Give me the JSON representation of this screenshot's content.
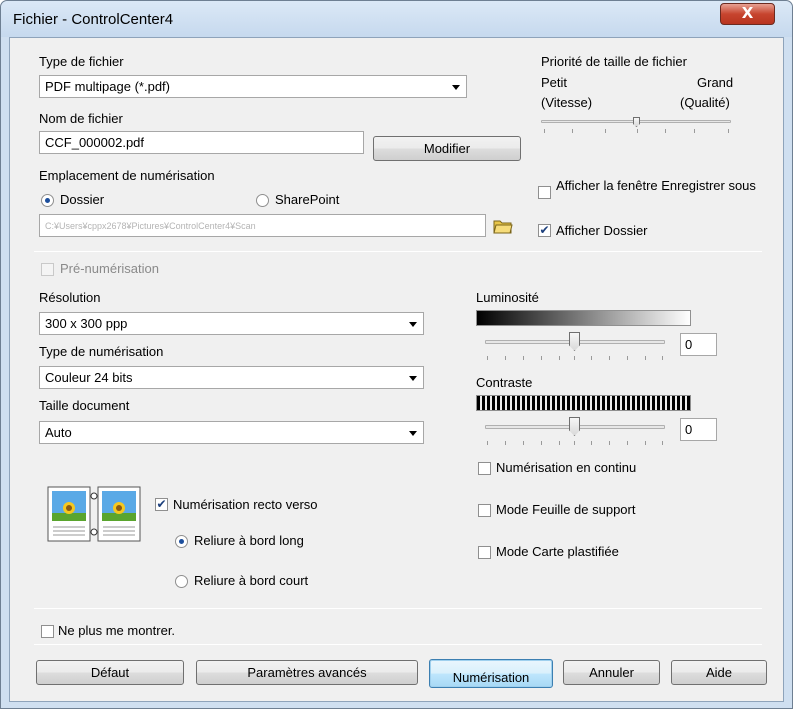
{
  "window": {
    "title": "Fichier - ControlCenter4",
    "close_glyph": "X"
  },
  "file": {
    "type_label": "Type de fichier",
    "type_value": "PDF multipage (*.pdf)",
    "name_label": "Nom de fichier",
    "name_value": "CCF_000002.pdf",
    "modify_button": "Modifier"
  },
  "filesize": {
    "label": "Priorité de taille de fichier",
    "small_label": "Petit",
    "large_label": "Grand",
    "speed_label": "(Vitesse)",
    "quality_label": "(Qualité)",
    "level_fraction": 0.6
  },
  "location": {
    "label": "Emplacement de numérisation",
    "option_folder": "Dossier",
    "option_sharepoint": "SharePoint",
    "selected": "Dossier",
    "path_value": "C:¥Users¥cppx2678¥Pictures¥ControlCenter4¥Scan",
    "folder_icon": "folder-icon",
    "show_save_window": "Afficher la fenêtre Enregistrer sous",
    "show_save_window_checked": false,
    "show_folder": "Afficher Dossier",
    "show_folder_checked": true
  },
  "prescan": {
    "label": "Pré-numérisation",
    "checked": false
  },
  "scan": {
    "resolution_label": "Résolution",
    "resolution_value": "300 x 300 ppp",
    "scan_type_label": "Type de numérisation",
    "scan_type_value": "Couleur 24 bits",
    "doc_size_label": "Taille document",
    "doc_size_value": "Auto"
  },
  "brightness": {
    "label": "Luminosité",
    "value": "0",
    "level_fraction": 0.5
  },
  "contrast": {
    "label": "Contraste",
    "value": "0",
    "level_fraction": 0.5
  },
  "duplex": {
    "icon": "duplex-book-icon",
    "label": "Numérisation recto verso",
    "checked": true,
    "long_edge": "Reliure à bord long",
    "short_edge": "Reliure à bord court",
    "selected": "long_edge"
  },
  "options": {
    "continuous": "Numérisation en continu",
    "carrier_sheet": "Mode Feuille de support",
    "plastic_card": "Mode Carte plastifiée"
  },
  "dont_show_again": "Ne plus me montrer.",
  "buttons": {
    "default": "Défaut",
    "advanced": "Paramètres avancés",
    "scan": "Numérisation",
    "cancel": "Annuler",
    "help": "Aide"
  },
  "colors": {
    "titlebar": "#c6d9ee",
    "client_bg": "#f0f0f0",
    "close_red": "#c7452f",
    "default_button_border": "#3c7fb1"
  }
}
